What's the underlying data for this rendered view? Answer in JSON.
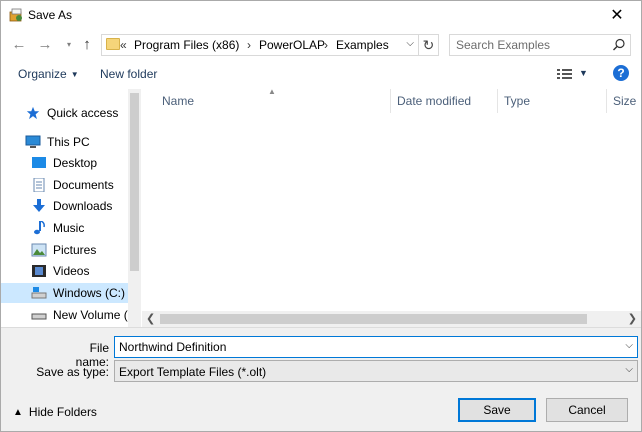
{
  "window": {
    "title": "Save As"
  },
  "address": {
    "overflow": "«",
    "crumbs": [
      "Program Files (x86)",
      "PowerOLAP",
      "Examples"
    ],
    "separator": "›"
  },
  "search": {
    "placeholder": "Search Examples"
  },
  "toolbar": {
    "organize": "Organize",
    "new_folder": "New folder",
    "help": "?"
  },
  "nav": {
    "items": [
      {
        "label": "Quick access",
        "icon": "star-icon"
      },
      {
        "label": "This PC",
        "icon": "computer-icon"
      },
      {
        "label": "Desktop",
        "icon": "desktop-icon"
      },
      {
        "label": "Documents",
        "icon": "documents-icon"
      },
      {
        "label": "Downloads",
        "icon": "download-icon"
      },
      {
        "label": "Music",
        "icon": "music-icon"
      },
      {
        "label": "Pictures",
        "icon": "pictures-icon"
      },
      {
        "label": "Videos",
        "icon": "videos-icon"
      },
      {
        "label": "Windows (C:)",
        "icon": "drive-icon",
        "selected": true
      },
      {
        "label": "New Volume (D:",
        "icon": "drive-icon"
      }
    ]
  },
  "columns": [
    "Name",
    "Date modified",
    "Type",
    "Size"
  ],
  "fields": {
    "filename_label": "File name:",
    "filename_value": "Northwind Definition",
    "type_label": "Save as type:",
    "type_value": "Export Template Files (*.olt)"
  },
  "footer": {
    "hide_folders": "Hide Folders",
    "save": "Save",
    "cancel": "Cancel"
  },
  "colors": {
    "accent": "#0078d7",
    "selected_bg": "#cce8ff",
    "link_text": "#1e395b"
  }
}
